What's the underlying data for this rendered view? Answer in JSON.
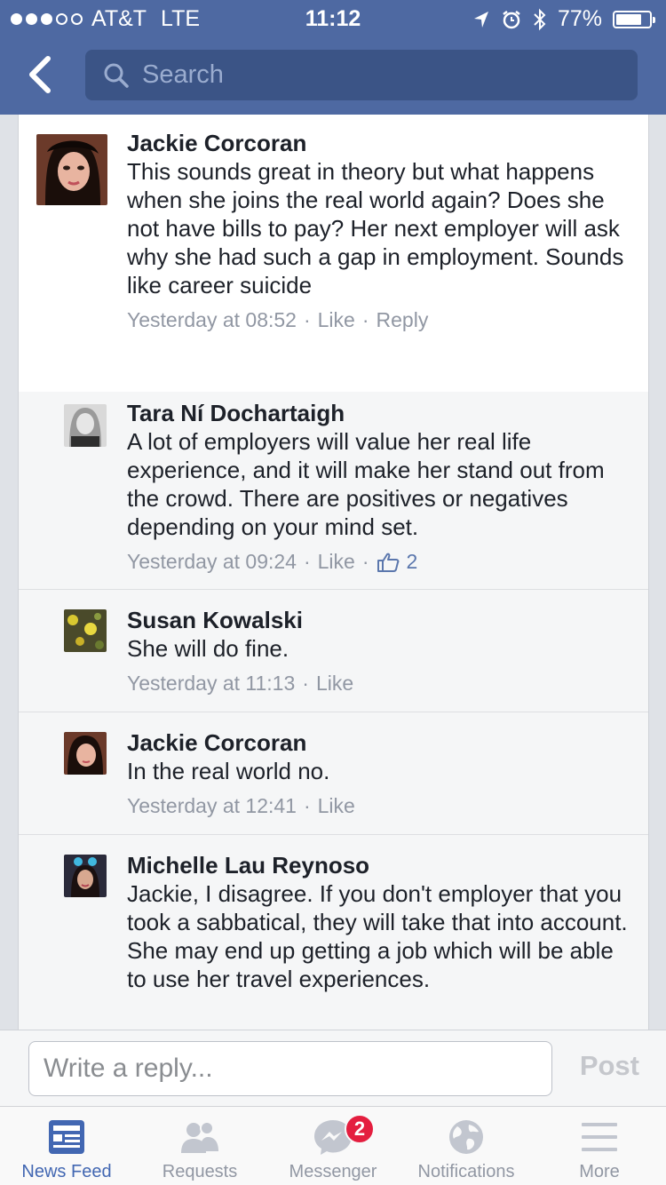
{
  "status_bar": {
    "carrier": "AT&T",
    "network": "LTE",
    "time": "11:12",
    "battery": "77%",
    "battery_level": 0.77
  },
  "nav": {
    "search_placeholder": "Search"
  },
  "comments": [
    {
      "name": "Jackie Corcoran",
      "text": "This sounds great in theory but what happens when she joins the real world again? Does she not have bills to pay? Her next employer will ask why she had such a gap in employment. Sounds like career suicide",
      "time": "Yesterday at 08:52",
      "like": "Like",
      "reply": "Reply"
    },
    {
      "name": "Tara Ní Dochartaigh",
      "text": "A lot of employers will value her real life experience, and it will make her stand out from the crowd. There are positives or negatives depending on your mind set.",
      "time": "Yesterday at 09:24",
      "like": "Like",
      "likes_count": "2"
    },
    {
      "name": "Susan Kowalski",
      "text": "She will do fine.",
      "time": "Yesterday at 11:13",
      "like": "Like"
    },
    {
      "name": "Jackie Corcoran",
      "text": "In the real world no.",
      "time": "Yesterday at 12:41",
      "like": "Like"
    },
    {
      "name": "Michelle Lau Reynoso",
      "text": "Jackie, I disagree. If you don't employer that you took a sabbatical, they will take that into account. She may end up getting a job which will be able to use her travel experiences."
    }
  ],
  "reply_bar": {
    "placeholder": "Write a reply...",
    "post_label": "Post"
  },
  "tabs": [
    {
      "label": "News Feed",
      "icon": "news-feed-icon"
    },
    {
      "label": "Requests",
      "icon": "friend-requests-icon"
    },
    {
      "label": "Messenger",
      "icon": "messenger-icon",
      "badge": "2"
    },
    {
      "label": "Notifications",
      "icon": "globe-icon"
    },
    {
      "label": "More",
      "icon": "menu-icon"
    }
  ],
  "colors": {
    "header": "#4e69a2",
    "active_tab": "#4267b2",
    "badge": "#e41e3f"
  }
}
